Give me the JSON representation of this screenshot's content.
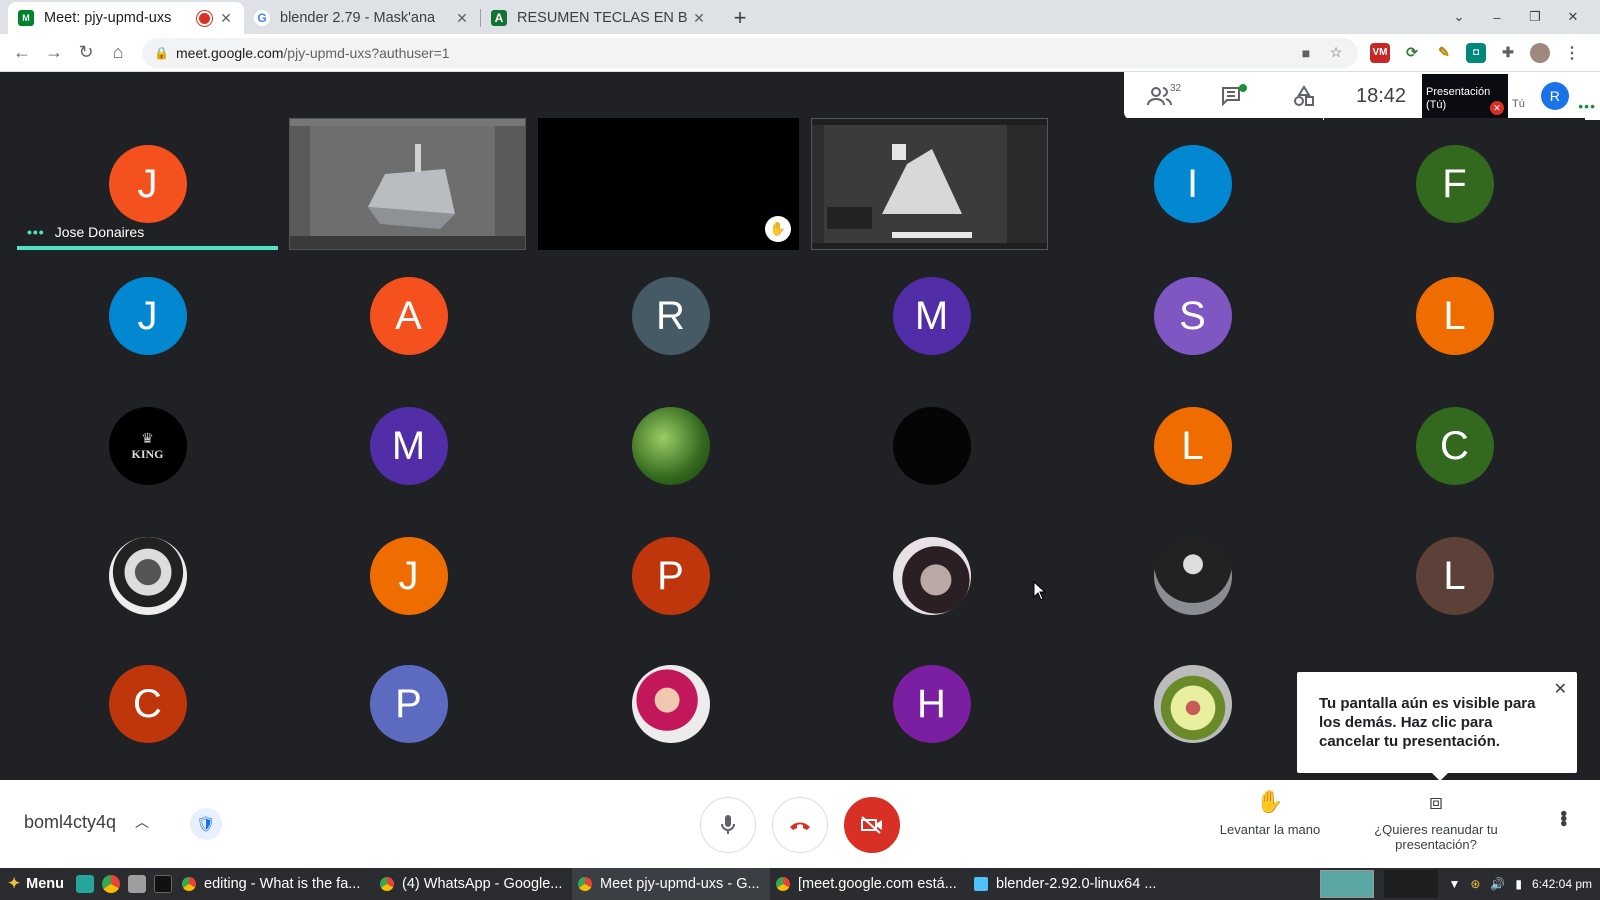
{
  "browser": {
    "tabs": [
      {
        "title": "Meet: pjy-upmd-uxs",
        "favicon": "meet-icon",
        "active": true,
        "recording": true
      },
      {
        "title": "blender 2.79 - Mask'ana",
        "favicon": "google-icon",
        "active": false
      },
      {
        "title": "RESUMEN TECLAS EN B",
        "favicon": "docs-icon",
        "active": false
      }
    ],
    "url_host": "meet.google.com",
    "url_path": "/pjy-upmd-uxs?authuser=1"
  },
  "infobar": {
    "participants_count": "32",
    "time": "18:42",
    "presentation_label": "Presentación (Tú)",
    "you_label": "Tú",
    "avatar_letter": "R"
  },
  "grid": {
    "speaker_name": "Jose Donaires",
    "tiles": [
      {
        "letter": "J",
        "color": "#f4511e",
        "speaking": true
      },
      {
        "letter": "I",
        "color": "#0288d1"
      },
      {
        "letter": "F",
        "color": "#33691e"
      },
      {
        "letter": "J",
        "color": "#0288d1"
      },
      {
        "letter": "A",
        "color": "#f4511e"
      },
      {
        "letter": "R",
        "color": "#455a64"
      },
      {
        "letter": "M",
        "color": "#512da8"
      },
      {
        "letter": "S",
        "color": "#7e57c2"
      },
      {
        "letter": "L",
        "color": "#ef6c00"
      },
      {
        "letter": "KING",
        "color": "#000000",
        "photo": true
      },
      {
        "letter": "M",
        "color": "#512da8"
      },
      {
        "letter": "",
        "color": "#3f6e2a",
        "photo": true
      },
      {
        "letter": "",
        "color": "#050505",
        "photo": true
      },
      {
        "letter": "L",
        "color": "#ef6c00"
      },
      {
        "letter": "C",
        "color": "#33691e"
      },
      {
        "letter": "",
        "color": "#e0e0e0",
        "photo": true
      },
      {
        "letter": "J",
        "color": "#ef6c00"
      },
      {
        "letter": "P",
        "color": "#bf360c"
      },
      {
        "letter": "",
        "color": "#cfc7cc",
        "photo": true
      },
      {
        "letter": "",
        "color": "#5d5f64",
        "photo": true
      },
      {
        "letter": "L",
        "color": "#5d4037"
      },
      {
        "letter": "C",
        "color": "#bf360c"
      },
      {
        "letter": "P",
        "color": "#5c6bc0"
      },
      {
        "letter": "",
        "color": "#c2455a",
        "photo": true
      },
      {
        "letter": "H",
        "color": "#7b1fa2"
      },
      {
        "letter": "",
        "color": "#8aa05a",
        "photo": true
      }
    ]
  },
  "tooltip": {
    "text": "Tu pantalla aún es visible para los demás. Haz clic para cancelar tu presentación."
  },
  "bottombar": {
    "meeting_code": "boml4cty4q",
    "raise_hand_label": "Levantar la mano",
    "resume_label": "¿Quieres reanudar tu presentación?"
  },
  "taskbar": {
    "menu_label": "Menu",
    "windows": [
      "editing - What is the fa...",
      "(4) WhatsApp - Google...",
      "Meet pjy-upmd-uxs - G...",
      "[meet.google.com está...",
      "blender-2.92.0-linux64 ..."
    ],
    "clock": "6:42:04 pm"
  },
  "colors": {
    "accent": "#1a73e8",
    "danger": "#d93025",
    "speaking": "#4fe3c8",
    "meet_bg": "#202124"
  }
}
